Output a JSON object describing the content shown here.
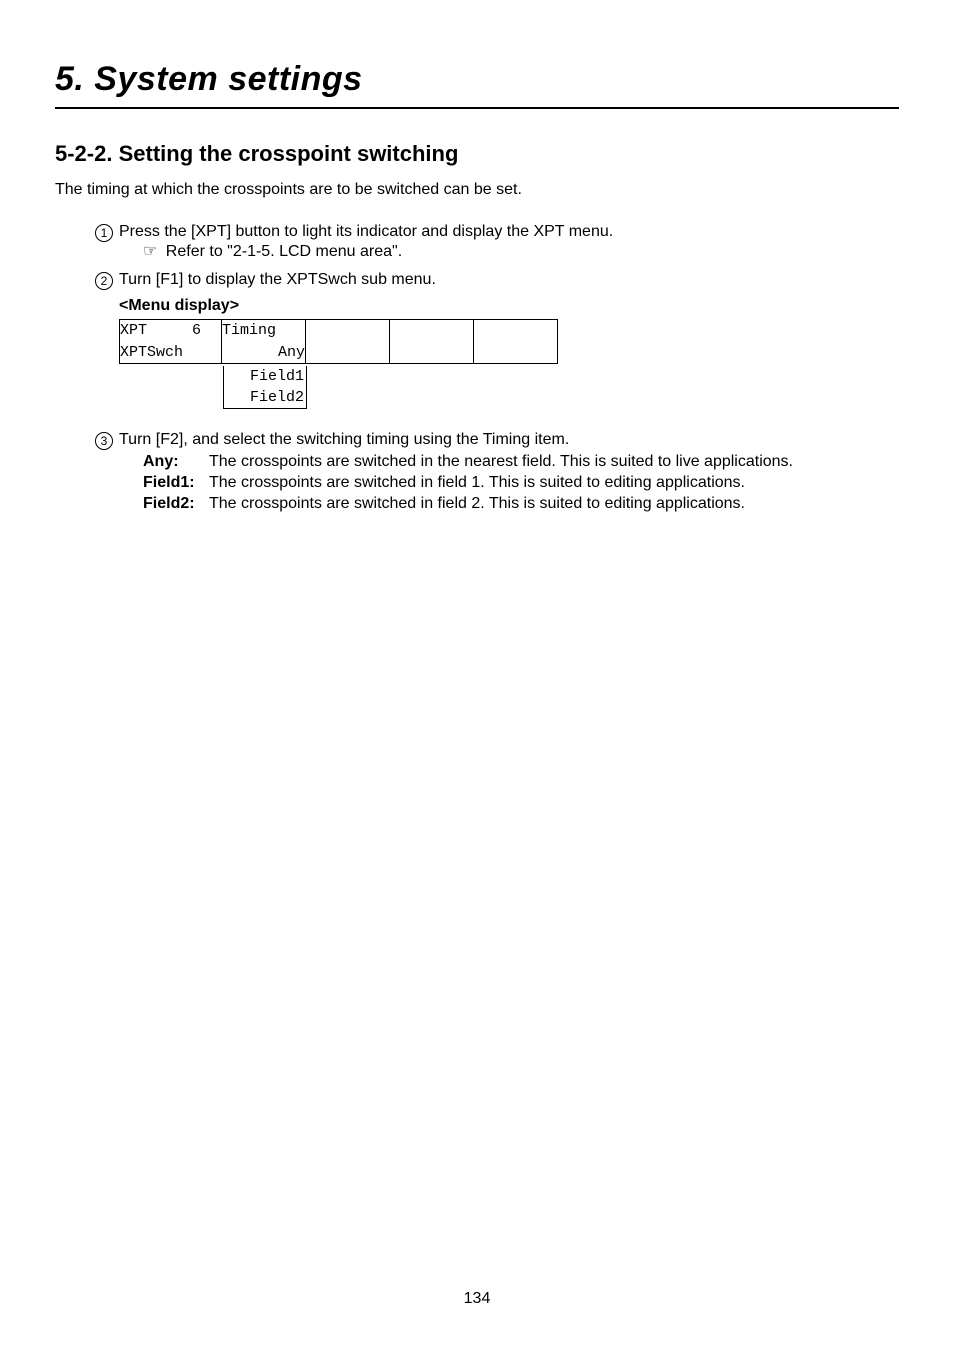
{
  "chapter": {
    "title": "5. System settings"
  },
  "section": {
    "number": "5-2-2.",
    "title": "Setting the crosspoint switching"
  },
  "intro": "The timing at which the crosspoints are to be switched can be set.",
  "steps": {
    "s1": {
      "num": "1",
      "text": "Press the [XPT] button to light its indicator and display the XPT menu.",
      "sub_pointer": "☞",
      "sub_text": "Refer to \"2-1-5. LCD menu area\"."
    },
    "s2": {
      "num": "2",
      "text": "Turn [F1] to display the XPTSwch sub menu."
    },
    "s3": {
      "num": "3",
      "text": "Turn [F2], and select the switching timing using the Timing item."
    }
  },
  "menu_display_label": "<Menu display>",
  "menu_table": {
    "r1c1": "XPT     6",
    "r1c2": "Timing ",
    "r1c3": "",
    "r1c4": "",
    "r1c5": "",
    "r2c1": "XPTSwch  ",
    "r2c2": "Any",
    "r2c3": "",
    "r2c4": "",
    "r2c5": ""
  },
  "dropdown": {
    "opt1": "Field1",
    "opt2": "Field2"
  },
  "defs": {
    "any": {
      "term": "Any:",
      "desc": "The crosspoints are switched in the nearest field. This is suited to live applications."
    },
    "f1": {
      "term": "Field1:",
      "desc": "The crosspoints are switched in field 1. This is suited to editing applications."
    },
    "f2": {
      "term": "Field2:",
      "desc": "The crosspoints are switched in field 2. This is suited to editing applications."
    }
  },
  "page_number": "134"
}
